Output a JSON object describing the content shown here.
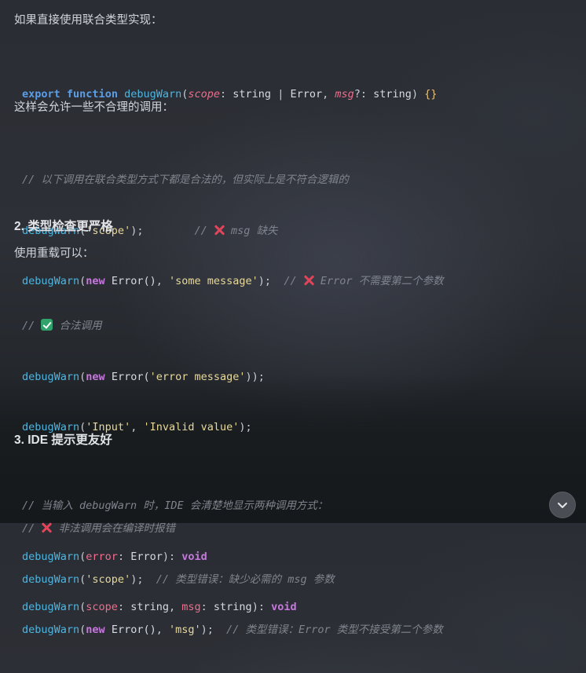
{
  "intro_text": "如果直接使用联合类型实现：",
  "code1": {
    "kw_export": "export",
    "kw_function": "function",
    "fn_name": "debugWarn",
    "p_open": "(",
    "param_scope": "scope",
    "colon1": ": ",
    "type_string1": "string",
    "pipe": " | ",
    "type_error": "Error",
    "comma1": ", ",
    "param_msg": "msg",
    "opt_colon": "?: ",
    "type_string2": "string",
    "p_close": ")",
    "braces": "{}"
  },
  "allow_text": "这样会允许一些不合理的调用：",
  "code2": {
    "comment_title": "// 以下调用在联合类型方式下都是合法的，但实际上是不符合逻辑的",
    "line1_fn": "debugWarn",
    "line1_arg": "'scope'",
    "line1_end": ");",
    "line1_comment_a": "// ",
    "line1_comment_b": " msg 缺失",
    "line2_fn": "debugWarn",
    "line2_new": "new",
    "line2_class": " Error()",
    "line2_comma": ", ",
    "line2_arg": "'some message'",
    "line2_end": ");",
    "line2_comment_a": "// ",
    "line2_comment_b": " Error 不需要第二个参数"
  },
  "heading2": "2. 类型检查更严格",
  "overload_text": "使用重载可以：",
  "code3": {
    "ok_comment_a": "// ",
    "ok_comment_b": " 合法调用",
    "l1_fn": "debugWarn",
    "l1_new": "new",
    "l1_class": " Error(",
    "l1_arg": "'error message'",
    "l1_end": "));",
    "l2_fn": "debugWarn",
    "l2_arg1": "'Input'",
    "l2_comma": ", ",
    "l2_arg2": "'Invalid value'",
    "l2_end": ");",
    "bad_comment_a": "// ",
    "bad_comment_b": " 非法调用会在编译时报错",
    "l3_fn": "debugWarn",
    "l3_arg": "'scope'",
    "l3_end": ");",
    "l3_comment": "// 类型错误：缺少必需的 msg 参数",
    "l4_fn": "debugWarn",
    "l4_new": "new",
    "l4_class": " Error()",
    "l4_comma": ", ",
    "l4_arg": "'msg'",
    "l4_end": ");",
    "l4_comment": "// 类型错误：Error 类型不接受第二个参数"
  },
  "heading3": "3. IDE 提示更友好",
  "code4": {
    "comment": "// 当输入 debugWarn 时，IDE 会清楚地显示两种调用方式：",
    "l1_fn": "debugWarn",
    "l1_param": "error",
    "l1_colon": ": ",
    "l1_type": "Error",
    "l1_close": "): ",
    "l1_ret": "void",
    "l2_fn": "debugWarn",
    "l2_param1": "scope",
    "l2_colon1": ": ",
    "l2_type1": "string",
    "l2_comma": ", ",
    "l2_param2": "msg",
    "l2_colon2": ": ",
    "l2_type2": "string",
    "l2_close": "): ",
    "l2_ret": "void"
  },
  "scroll_button": {
    "icon": "chevron-down-icon"
  }
}
